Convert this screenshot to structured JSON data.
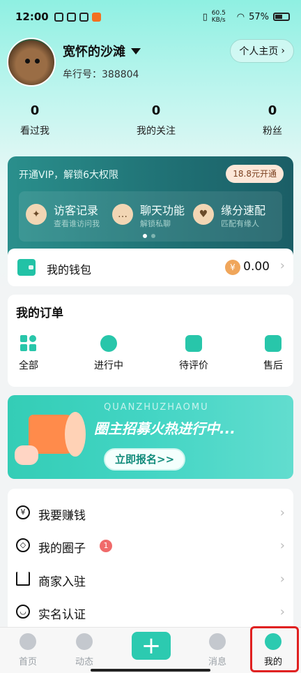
{
  "status_bar": {
    "time": "12:00",
    "net_speed": "60.5 KB/s",
    "battery": "57%"
  },
  "profile": {
    "nickname": "宽怀的沙滩",
    "user_id": "牟行号：388804",
    "homepage_button": "个人主页"
  },
  "stats": [
    {
      "value": "0",
      "label": "看过我"
    },
    {
      "value": "0",
      "label": "我的关注"
    },
    {
      "value": "0",
      "label": "粉丝"
    }
  ],
  "vip": {
    "title": "开通VIP，解锁6大权限",
    "button": "18.8元开通",
    "features": [
      {
        "name": "访客记录",
        "desc": "查看谁访问我",
        "icon": "visitor-icon"
      },
      {
        "name": "聊天功能",
        "desc": "解锁私聊",
        "icon": "chat-icon"
      },
      {
        "name": "缘分速配",
        "desc": "匹配有缘人",
        "icon": "heart-icon"
      }
    ]
  },
  "wallet": {
    "label": "我的钱包",
    "coin_symbol": "¥",
    "amount": "0.00"
  },
  "orders": {
    "title": "我的订单",
    "items": [
      {
        "label": "全部",
        "icon": "grid-icon"
      },
      {
        "label": "进行中",
        "icon": "moon-icon"
      },
      {
        "label": "待评价",
        "icon": "comment-icon"
      },
      {
        "label": "售后",
        "icon": "after-sale-icon"
      }
    ]
  },
  "banner": {
    "subtitle": "QUANZHUZHAOMU",
    "title": "圈主招募火热进行中...",
    "cta": "立即报名>>"
  },
  "menu": [
    {
      "label": "我要赚钱",
      "icon": "yen-icon",
      "badge": ""
    },
    {
      "label": "我的圈子",
      "icon": "compass-icon",
      "badge": "1"
    },
    {
      "label": "商家入驻",
      "icon": "building-icon",
      "badge": ""
    },
    {
      "label": "实名认证",
      "icon": "smile-icon",
      "badge": ""
    }
  ],
  "tabbar": {
    "tabs": [
      {
        "label": "首页",
        "icon": "home-icon"
      },
      {
        "label": "动态",
        "icon": "feed-icon"
      },
      {
        "label": "消息",
        "icon": "message-icon"
      },
      {
        "label": "我的",
        "icon": "me-icon"
      }
    ],
    "publish_symbol": "+",
    "active_color": "#2ccab0"
  }
}
